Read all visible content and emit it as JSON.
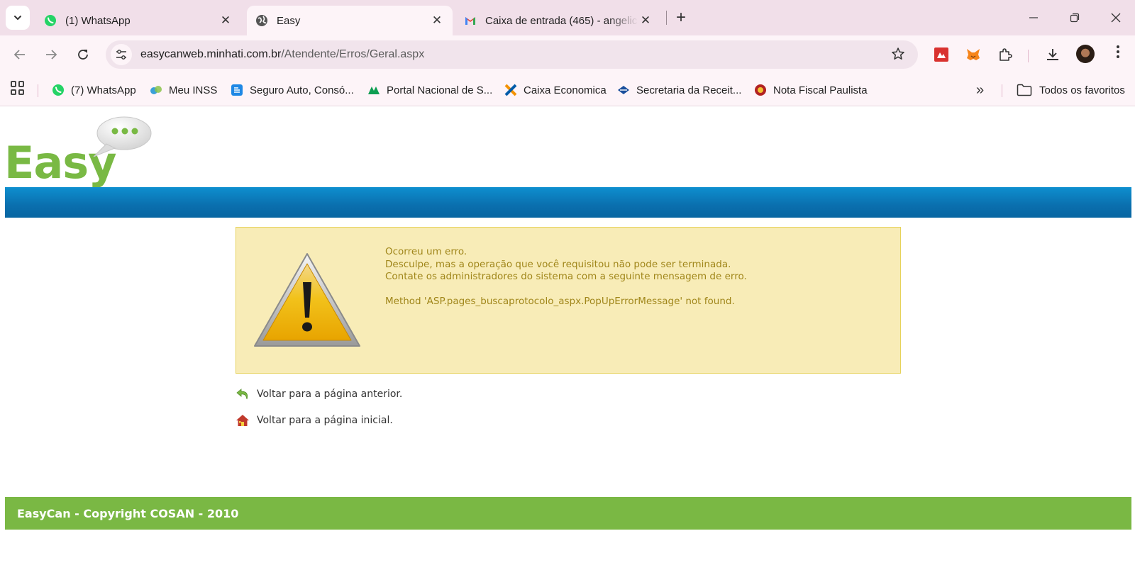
{
  "browser": {
    "tabs": [
      {
        "title": "(1) WhatsApp",
        "icon": "whatsapp-icon",
        "active": false
      },
      {
        "title": "Easy",
        "icon": "globe-icon",
        "active": true
      },
      {
        "title": "Caixa de entrada (465) - angelic",
        "icon": "gmail-icon",
        "active": false
      }
    ],
    "new_tab": "+",
    "url": {
      "host": "easycanweb.minhati.com.br",
      "path": "/Atendente/Erros/Geral.aspx"
    },
    "bookmarks": [
      {
        "label": "(7) WhatsApp",
        "icon": "whatsapp-icon"
      },
      {
        "label": "Meu INSS",
        "icon": "inss-icon"
      },
      {
        "label": "Seguro Auto, Consó...",
        "icon": "seguro-icon"
      },
      {
        "label": "Portal Nacional de S...",
        "icon": "portal-icon"
      },
      {
        "label": "Caixa Economica",
        "icon": "caixa-icon"
      },
      {
        "label": "Secretaria da Receit...",
        "icon": "receita-icon"
      },
      {
        "label": "Nota Fiscal Paulista",
        "icon": "nota-fiscal-icon"
      }
    ],
    "all_bookmarks": "Todos os favoritos",
    "more_bookmarks": "»"
  },
  "page": {
    "logo_text": "Easy",
    "error": {
      "line1": "Ocorreu um erro.",
      "line2": "Desculpe, mas a operação que você requisitou não pode ser terminada.",
      "line3": "Contate os administradores do sistema com a seguinte mensagem de erro.",
      "message": "Method 'ASP.pages_buscaprotocolo_aspx.PopUpErrorMessage' not found."
    },
    "links": {
      "back": "Voltar para a página anterior.",
      "home": "Voltar para a página inicial."
    },
    "footer": "EasyCan - Copyright COSAN - 2010"
  },
  "colors": {
    "brand_green": "#7ab844",
    "header_blue": "#0a6fae",
    "error_bg": "#f8ecb7",
    "error_text": "#a0861a"
  }
}
